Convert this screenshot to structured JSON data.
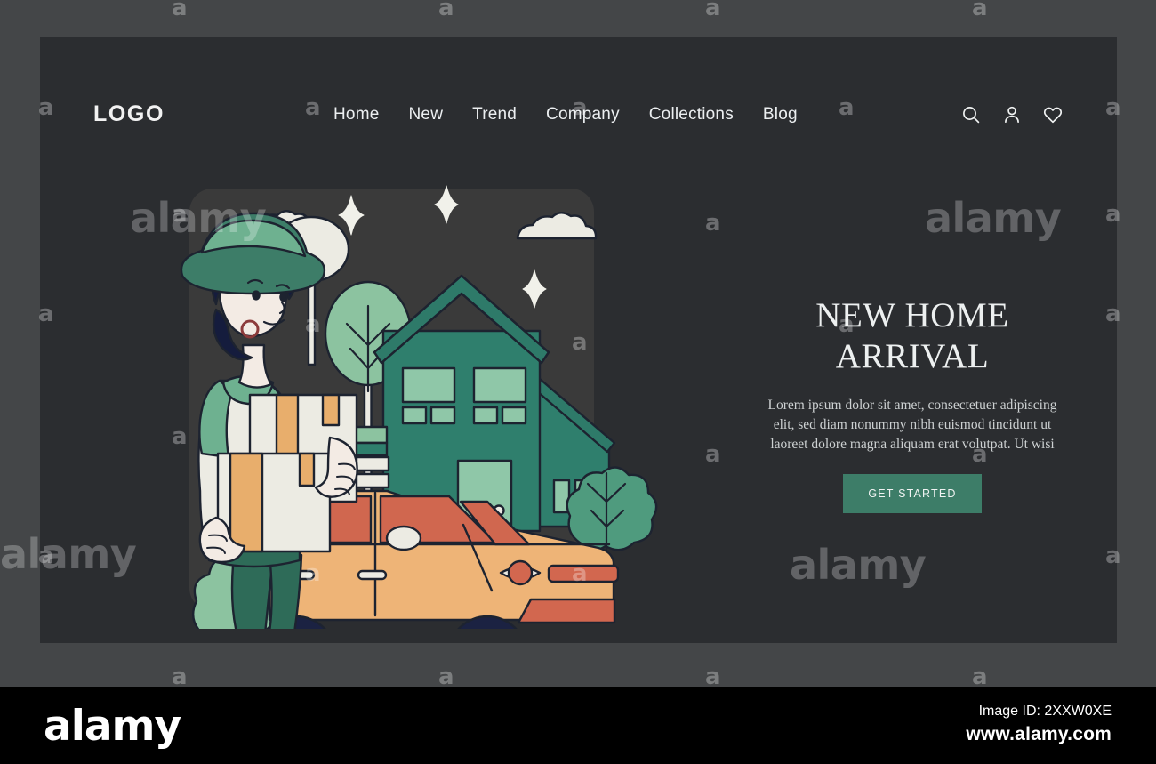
{
  "site": {
    "logo_text": "LOGO"
  },
  "nav": {
    "items": [
      {
        "label": "Home"
      },
      {
        "label": "New"
      },
      {
        "label": "Trend"
      },
      {
        "label": "Company"
      },
      {
        "label": "Collections"
      },
      {
        "label": "Blog"
      }
    ]
  },
  "header_icons": [
    {
      "name": "search-icon"
    },
    {
      "name": "user-icon"
    },
    {
      "name": "heart-icon"
    }
  ],
  "hero": {
    "title_line1": "NEW HOME",
    "title_line2": "ARRIVAL",
    "body": "Lorem ipsum dolor sit amet, consectetuer adipiscing elit, sed diam nonummy nibh euismod tincidunt ut laoreet dolore magna aliquam erat volutpat. Ut wisi",
    "cta_label": "GET STARTED"
  },
  "colors": {
    "page_background": "#2b2d30",
    "outer_frame": "#444648",
    "card_background": "#3a3a3a",
    "accent_green": "#3d7d68",
    "house_roof": "#2e7a69",
    "house_body": "#2f7f6d",
    "house_window": "#8fc7a8",
    "car_body": "#eeb477",
    "car_glass": "#d0674f",
    "wheel_navy": "#1b2242",
    "wheel_hub": "#d2674f",
    "foliage_light": "#8cc3a0",
    "foliage_mid": "#5ba183",
    "cream": "#ecece4",
    "hair_navy": "#151c3d",
    "skin": "#f3ebe4",
    "pants_green": "#2e6b58",
    "box_tan": "#e8ae6c"
  },
  "watermark": {
    "text": "alamy"
  },
  "footer": {
    "brand": "alamy",
    "image_id": "Image ID: 2XXW0XE",
    "url": "www.alamy.com"
  }
}
